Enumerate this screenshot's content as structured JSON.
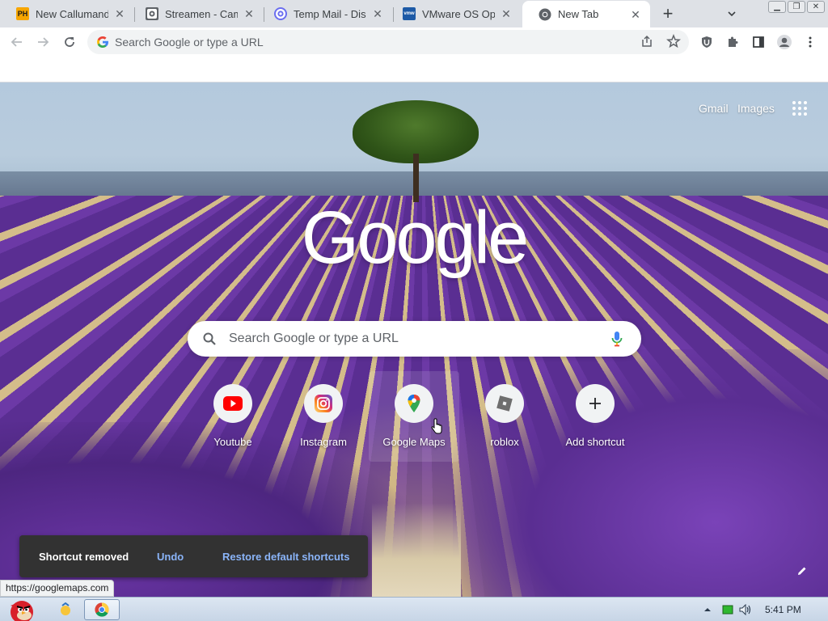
{
  "tabs": [
    {
      "title": "New Callumandt",
      "favicon": "ph-icon",
      "active": false
    },
    {
      "title": "Streamen - Cam",
      "favicon": "camera-icon",
      "active": false
    },
    {
      "title": "Temp Mail - Disp",
      "favicon": "at-sign-icon",
      "active": false
    },
    {
      "title": "VMware OS Opt",
      "favicon": "vmware-icon",
      "active": false
    },
    {
      "title": "New Tab",
      "favicon": "chrome-icon",
      "active": true
    }
  ],
  "toolbar": {
    "omnibox_placeholder": "Search Google or type a URL"
  },
  "ntp": {
    "gmail_label": "Gmail",
    "images_label": "Images",
    "logo_text": "Google",
    "search_placeholder": "Search Google or type a URL",
    "shortcuts": [
      {
        "label": "Youtube",
        "icon": "youtube-icon"
      },
      {
        "label": "Instagram",
        "icon": "instagram-icon"
      },
      {
        "label": "Google Maps",
        "icon": "google-maps-icon"
      },
      {
        "label": "roblox",
        "icon": "roblox-icon"
      },
      {
        "label": "Add shortcut",
        "icon": "plus-icon"
      }
    ]
  },
  "toast": {
    "message": "Shortcut removed",
    "undo_label": "Undo",
    "restore_label": "Restore default shortcuts"
  },
  "status_url": "https://googlemaps.com",
  "taskbar": {
    "clock": "5:41 PM"
  },
  "colors": {
    "accent_link": "#8ab4f8",
    "tabstrip_bg": "#dee1e6",
    "toast_bg": "#323232",
    "youtube_red": "#ff0000"
  }
}
